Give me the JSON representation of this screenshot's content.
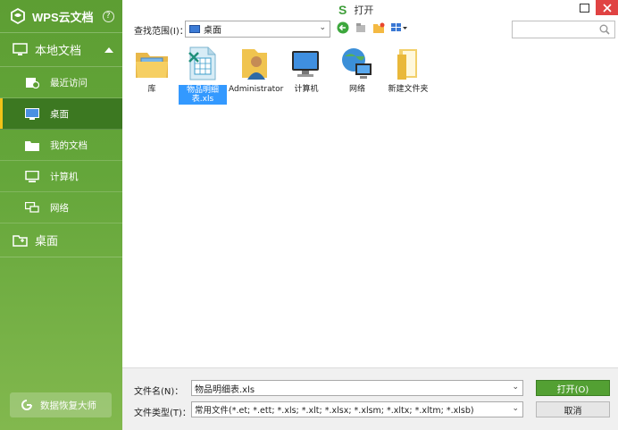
{
  "sidebar": {
    "app_title": "WPS云文档",
    "help_glyph": "?",
    "section_local": "本地文档",
    "items": [
      {
        "label": "最近访问",
        "icon": "recent-docs-icon"
      },
      {
        "label": "桌面",
        "icon": "desktop-icon",
        "active": true
      },
      {
        "label": "我的文档",
        "icon": "folder-icon"
      },
      {
        "label": "计算机",
        "icon": "computer-icon"
      },
      {
        "label": "网络",
        "icon": "network-icon"
      }
    ],
    "section_desktop": "桌面",
    "recover_label": "数据恢复大师"
  },
  "window": {
    "logo_glyph": "S",
    "title": "打开"
  },
  "toolbar": {
    "lookin_label": "查找范围(I)：",
    "lookin_value": "桌面",
    "search_placeholder": ""
  },
  "files": [
    {
      "name": "库",
      "icon": "library-icon"
    },
    {
      "name": "物品明细表.xls",
      "icon": "excel-file-icon",
      "selected": true
    },
    {
      "name": "Administrator",
      "icon": "user-folder-icon"
    },
    {
      "name": "计算机",
      "icon": "computer-icon"
    },
    {
      "name": "网络",
      "icon": "network-icon"
    },
    {
      "name": "新建文件夹",
      "icon": "folder-icon"
    }
  ],
  "bottom": {
    "filename_label": "文件名(N)：",
    "filename_value": "物品明细表.xls",
    "filetype_label": "文件类型(T)：",
    "filetype_value": "常用文件(*.et; *.ett; *.xls; *.xlt; *.xlsx; *.xlsm; *.xltx; *.xltm; *.xlsb)",
    "open_label": "打开(O)",
    "cancel_label": "取消"
  },
  "colors": {
    "sidebar_green": "#64a63a",
    "sidebar_active": "#3c7821",
    "open_button": "#53a033",
    "close_button": "#e04343",
    "selection_blue": "#3399ff"
  }
}
